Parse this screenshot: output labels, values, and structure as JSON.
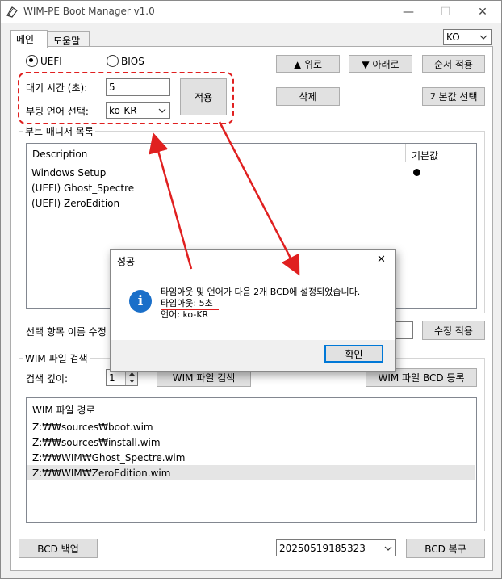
{
  "window": {
    "title": "WIM-PE Boot Manager v1.0",
    "minimize": "—",
    "maximize": "☐",
    "close": "✕"
  },
  "tabs": [
    {
      "label": "메인"
    },
    {
      "label": "도움말"
    }
  ],
  "language_select": {
    "value": "KO"
  },
  "boot_mode": {
    "uefi": "UEFI",
    "bios": "BIOS",
    "selected": "UEFI"
  },
  "timeout": {
    "label": "대기 시간 (초):",
    "value": "5"
  },
  "boot_language": {
    "label": "부팅 언어 선택:",
    "value": "ko-KR"
  },
  "buttons": {
    "apply": "적용",
    "up": "▲ 위로",
    "down": "▼ 아래로",
    "order_apply": "순서 적용",
    "delete": "삭제",
    "set_default": "기본값 선택",
    "rename_apply": "수정 적용",
    "wim_search": "WIM 파일 검색",
    "wim_register": "WIM 파일 BCD 등록",
    "bcd_backup": "BCD 백업",
    "bcd_restore": "BCD 복구"
  },
  "boot_list": {
    "group_label": "부트 매니저 목록",
    "columns": [
      "Description",
      "기본값"
    ],
    "entries": [
      {
        "description": "Windows Setup",
        "default": true
      },
      {
        "description": "(UEFI) Ghost_Spectre",
        "default": false
      },
      {
        "description": "(UEFI) ZeroEdition",
        "default": false
      }
    ]
  },
  "rename": {
    "label": "선택 항목 이름 수정",
    "value": ""
  },
  "wim_search": {
    "group_label": "WIM 파일 검색",
    "depth_label": "검색 깊이:",
    "depth_value": "1",
    "list_header": "WIM 파일 경로",
    "paths": [
      "Z:₩₩sources₩boot.wim",
      "Z:₩₩sources₩install.wim",
      "Z:₩₩WIM₩Ghost_Spectre.wim",
      "Z:₩₩WIM₩ZeroEdition.wim"
    ]
  },
  "backup_select": {
    "value": "20250519185323"
  },
  "dialog": {
    "title": "성공",
    "close": "✕",
    "message_line1": "타임아웃 및 언어가 다음 2개 BCD에 설정되었습니다.",
    "message_line2": "타임아웃: 5초",
    "message_line3": "언어: ko-KR",
    "ok": "확인",
    "icon_glyph": "i"
  },
  "colors": {
    "annotation_red": "#e02020",
    "focus_blue": "#0078d7",
    "info_blue": "#1a6fc9"
  }
}
